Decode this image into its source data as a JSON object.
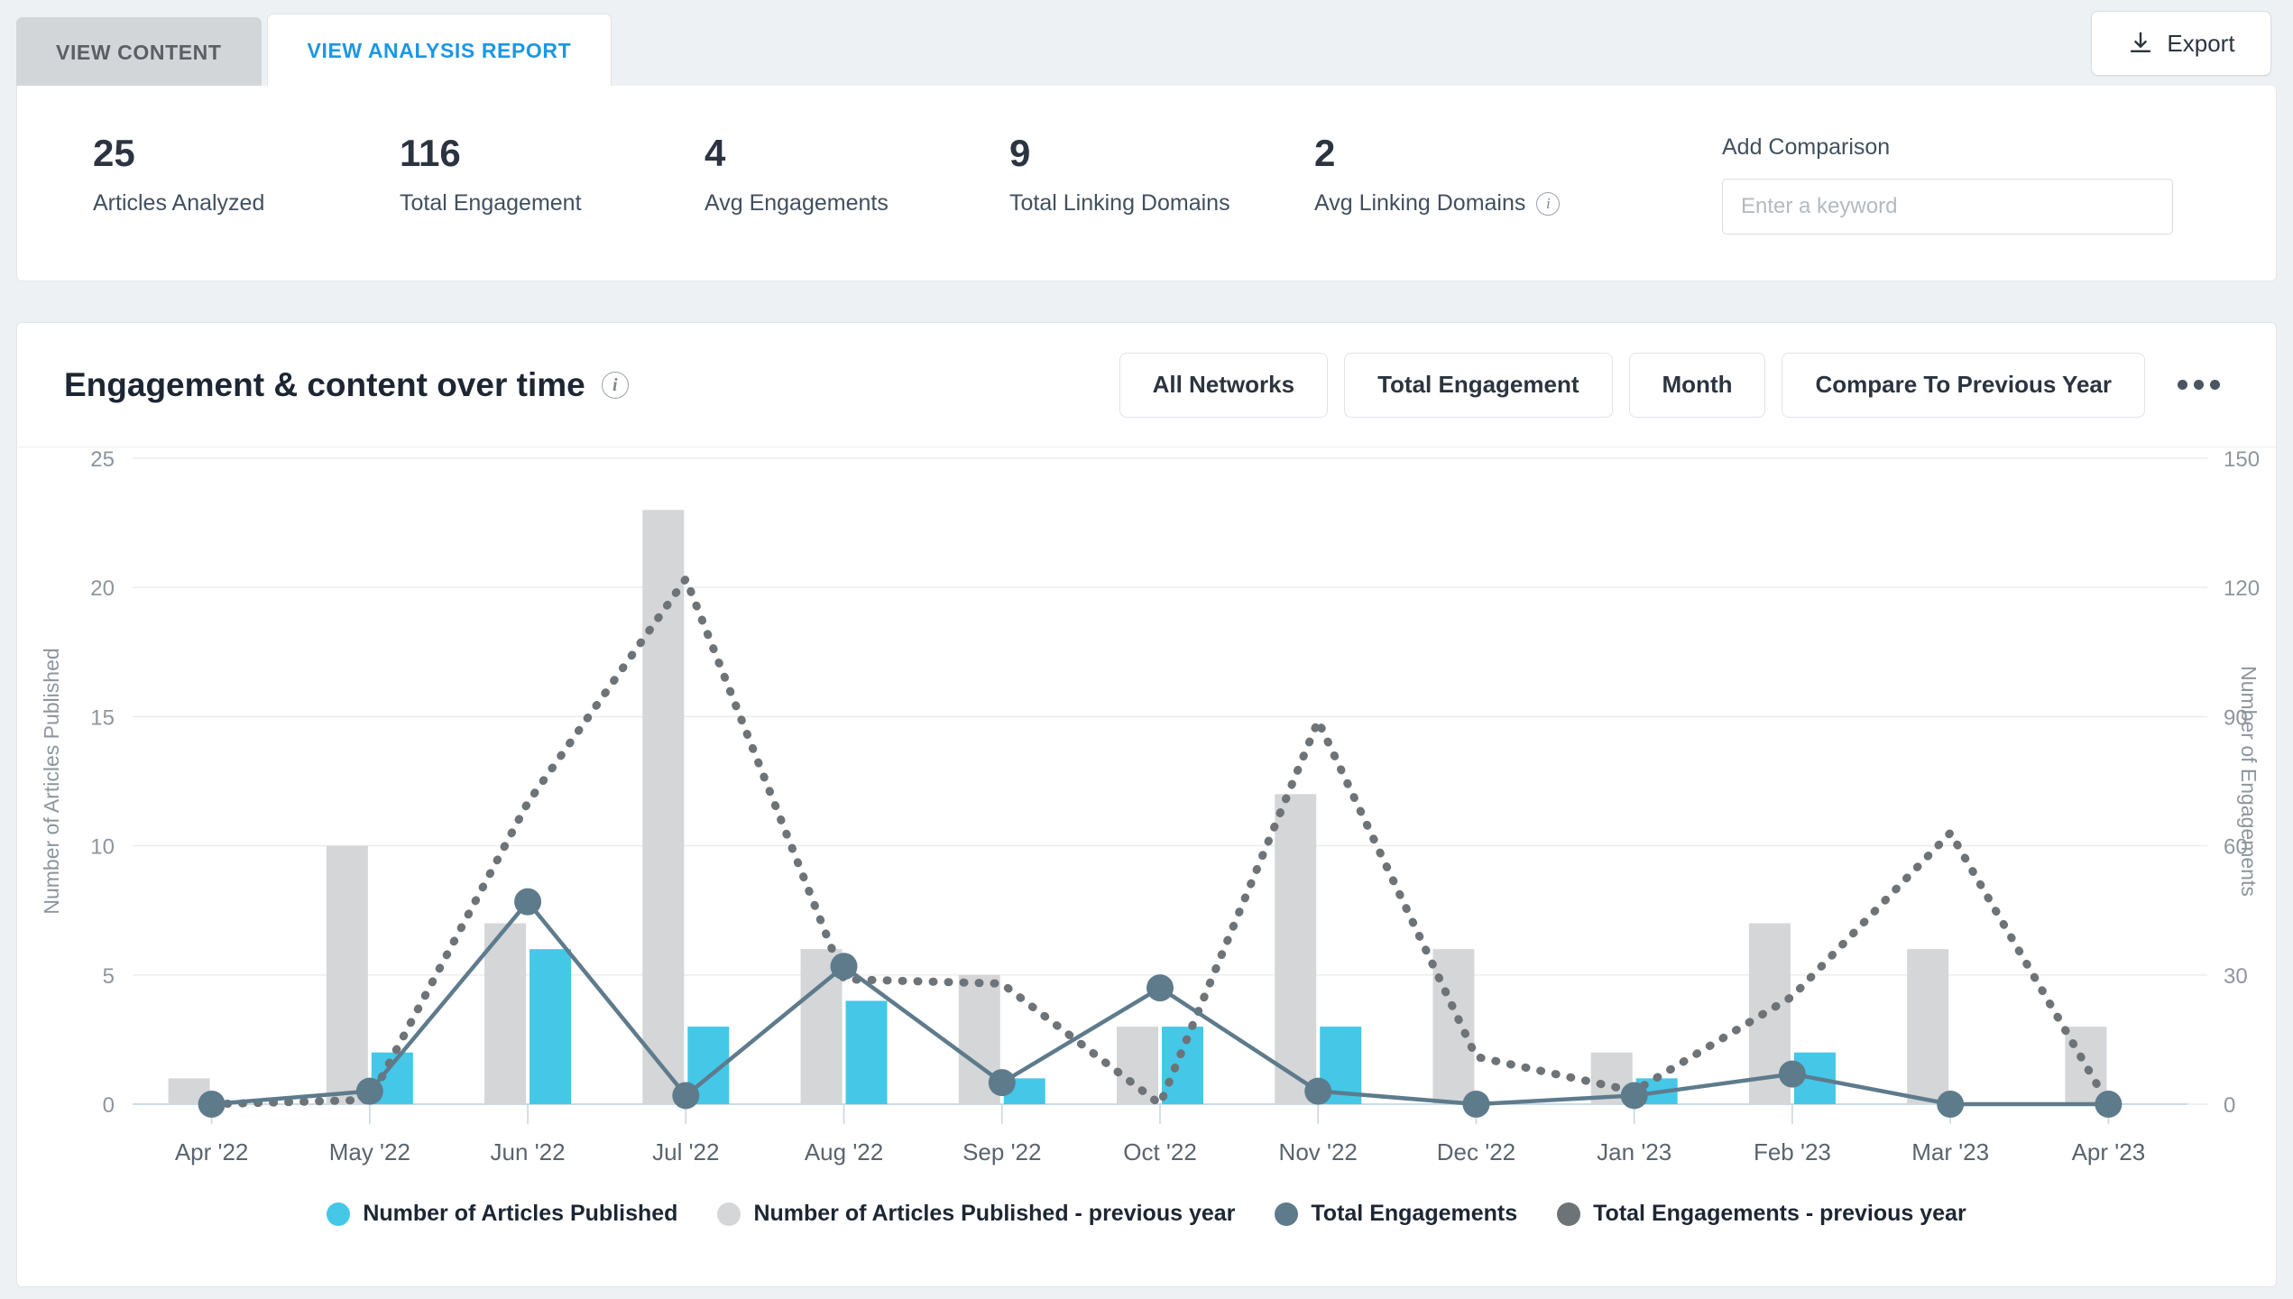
{
  "tabs": [
    {
      "label": "VIEW CONTENT",
      "active": false
    },
    {
      "label": "VIEW ANALYSIS REPORT",
      "active": true
    }
  ],
  "export": {
    "label": "Export",
    "icon": "download-icon"
  },
  "summary": {
    "stats": [
      {
        "value": "25",
        "label": "Articles Analyzed",
        "info": false
      },
      {
        "value": "116",
        "label": "Total Engagement",
        "info": false
      },
      {
        "value": "4",
        "label": "Avg Engagements",
        "info": false
      },
      {
        "value": "9",
        "label": "Total Linking Domains",
        "info": false
      },
      {
        "value": "2",
        "label": "Avg Linking Domains",
        "info": true
      }
    ],
    "comparison": {
      "label": "Add Comparison",
      "placeholder": "Enter a keyword",
      "value": ""
    }
  },
  "chart_panel": {
    "title": "Engagement & content over time",
    "filters": [
      "All Networks",
      "Total Engagement",
      "Month",
      "Compare To Previous Year"
    ],
    "more_label": "more-options"
  },
  "colors": {
    "accent_blue": "#1d97e3",
    "series_current_bar": "#45c7e8",
    "series_previous_bar": "#d4d6d8",
    "series_current_line": "#5e7b8c",
    "series_previous_line": "#6d7377",
    "text_dark": "#1d2633",
    "text_muted": "#7d8792",
    "card_bg": "#ffffff",
    "page_bg": "#eef1f4"
  },
  "chart_data": {
    "type": "bar",
    "title": "Engagement & content over time",
    "xlabel": "",
    "ylabel": "Number of Articles Published",
    "y2label": "Number of Engagements",
    "categories": [
      "Apr '22",
      "May '22",
      "Jun '22",
      "Jul '22",
      "Aug '22",
      "Sep '22",
      "Oct '22",
      "Nov '22",
      "Dec '22",
      "Jan '23",
      "Feb '23",
      "Mar '23",
      "Apr '23"
    ],
    "ylim": [
      0,
      25
    ],
    "yticks": [
      0,
      5,
      10,
      15,
      20,
      25
    ],
    "y2lim": [
      0,
      150
    ],
    "y2ticks": [
      0,
      30,
      60,
      90,
      120,
      150
    ],
    "grid": true,
    "legend_position": "bottom",
    "series": [
      {
        "name": "Number of Articles Published",
        "kind": "bar",
        "axis": "left",
        "color": "#45c7e8",
        "values": [
          0,
          2,
          6,
          3,
          4,
          1,
          3,
          3,
          0,
          1,
          2,
          0,
          0
        ]
      },
      {
        "name": "Number of Articles Published - previous year",
        "kind": "bar",
        "axis": "left",
        "color": "#d4d6d8",
        "values": [
          1,
          10,
          7,
          23,
          6,
          5,
          3,
          12,
          6,
          2,
          7,
          6,
          3
        ]
      },
      {
        "name": "Total Engagements",
        "kind": "line",
        "style": "solid",
        "axis": "right",
        "color": "#5e7b8c",
        "values": [
          0,
          3,
          47,
          2,
          32,
          5,
          27,
          3,
          0,
          2,
          7,
          0,
          0
        ]
      },
      {
        "name": "Total Engagements - previous year",
        "kind": "line",
        "style": "dotted",
        "axis": "right",
        "color": "#6d7377",
        "values": [
          0,
          1,
          70,
          122,
          29,
          28,
          0,
          89,
          11,
          3,
          25,
          63,
          0
        ]
      }
    ]
  }
}
